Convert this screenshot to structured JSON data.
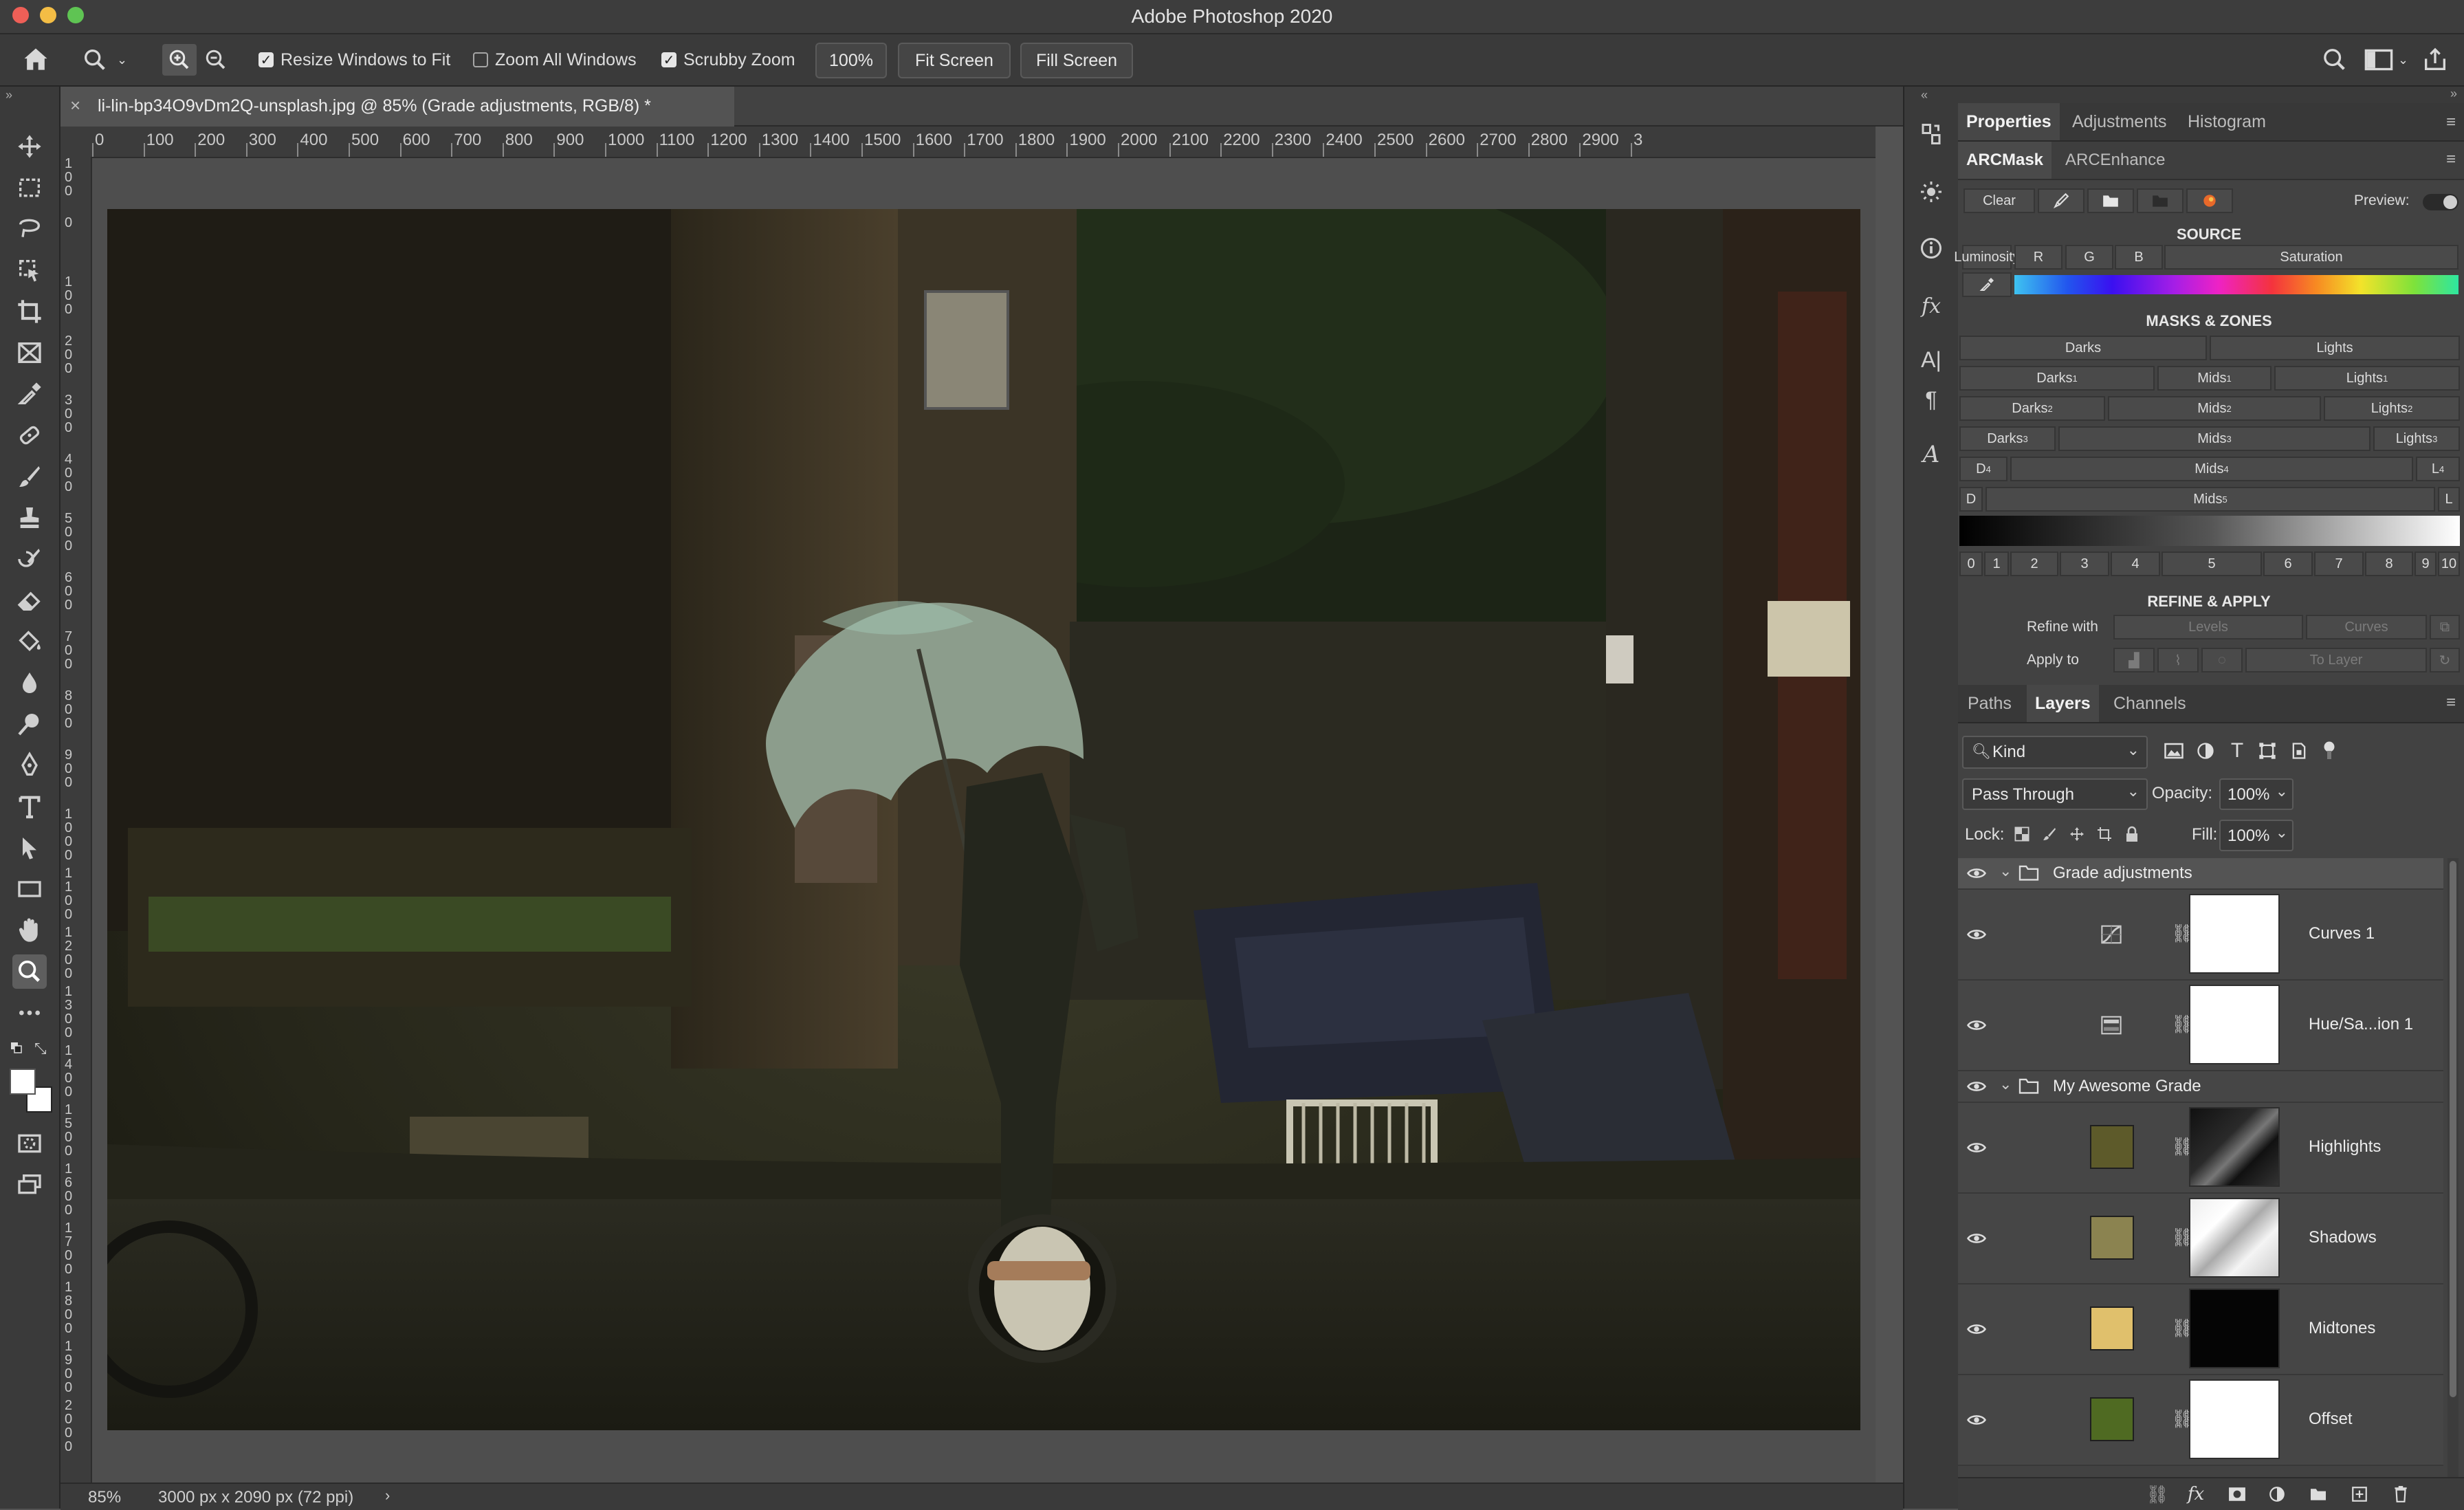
{
  "window": {
    "title": "Adobe Photoshop 2020"
  },
  "options_bar": {
    "resize_windows": "Resize Windows to Fit",
    "zoom_all": "Zoom All Windows",
    "scrubby_zoom": "Scrubby Zoom",
    "zoom_value": "100%",
    "fit_screen": "Fit Screen",
    "fill_screen": "Fill Screen"
  },
  "document": {
    "tab_title": "li-lin-bp34O9vDm2Q-unsplash.jpg @ 85% (Grade adjustments, RGB/8) *",
    "ruler_h": [
      "0",
      "100",
      "200",
      "300",
      "400",
      "500",
      "600",
      "700",
      "800",
      "900",
      "1000",
      "1100",
      "1200",
      "1300",
      "1400",
      "1500",
      "1600",
      "1700",
      "1800",
      "1900",
      "2000",
      "2100",
      "2200",
      "2300",
      "2400",
      "2500",
      "2600",
      "2700",
      "2800",
      "2900",
      "3"
    ],
    "ruler_v": [
      "100",
      "0",
      "100",
      "200",
      "300",
      "400",
      "500",
      "600",
      "700",
      "800",
      "900",
      "1000",
      "1100",
      "1200",
      "1300",
      "1400",
      "1500",
      "1600",
      "1700",
      "1800",
      "1900",
      "2000"
    ],
    "zoom": "85%",
    "info": "3000 px x 2090 px (72 ppi)"
  },
  "properties": {
    "tabs": [
      "Properties",
      "Adjustments",
      "Histogram"
    ],
    "subtabs": [
      "ARCMask",
      "ARCEnhance"
    ],
    "clear": "Clear",
    "preview": "Preview:",
    "source_title": "SOURCE",
    "source_buttons": [
      "Luminosity",
      "R",
      "G",
      "B",
      "Saturation"
    ],
    "masks_title": "MASKS & ZONES",
    "darks": "Darks",
    "lights": "Lights",
    "mids": "Mids",
    "d": "D",
    "l": "L",
    "sup1": "1",
    "sup2": "2",
    "sup3": "3",
    "sup4": "4",
    "sup5": "5",
    "scale": [
      "0",
      "1",
      "2",
      "3",
      "4",
      "5",
      "6",
      "7",
      "8",
      "9",
      "10"
    ],
    "refine_title": "REFINE & APPLY",
    "refine_with": "Refine with",
    "levels": "Levels",
    "curves": "Curves",
    "apply_to": "Apply to",
    "to_layer": "To Layer"
  },
  "layers_panel": {
    "tabs": [
      "Paths",
      "Layers",
      "Channels"
    ],
    "kind": "Kind",
    "blend_mode": "Pass Through",
    "opacity_label": "Opacity:",
    "opacity": "100%",
    "lock_label": "Lock:",
    "fill_label": "Fill:",
    "fill": "100%",
    "layers": [
      {
        "name": "Grade adjustments",
        "type": "group"
      },
      {
        "name": "Curves 1",
        "type": "adjustment",
        "icon": "curves-icon"
      },
      {
        "name": "Hue/Sa...ion 1",
        "type": "adjustment",
        "icon": "hue-saturation-icon"
      },
      {
        "name": "My Awesome Grade",
        "type": "group"
      },
      {
        "name": "Highlights",
        "type": "fill",
        "color": "#5d5a2a"
      },
      {
        "name": "Shadows",
        "type": "fill",
        "color": "#8b8350"
      },
      {
        "name": "Midtones",
        "type": "fill",
        "color": "#e0c06c"
      },
      {
        "name": "Offset",
        "type": "fill",
        "color": "#4f6a22"
      }
    ]
  },
  "colors": {
    "accent": "#3d7fdc",
    "panel": "#424242"
  }
}
